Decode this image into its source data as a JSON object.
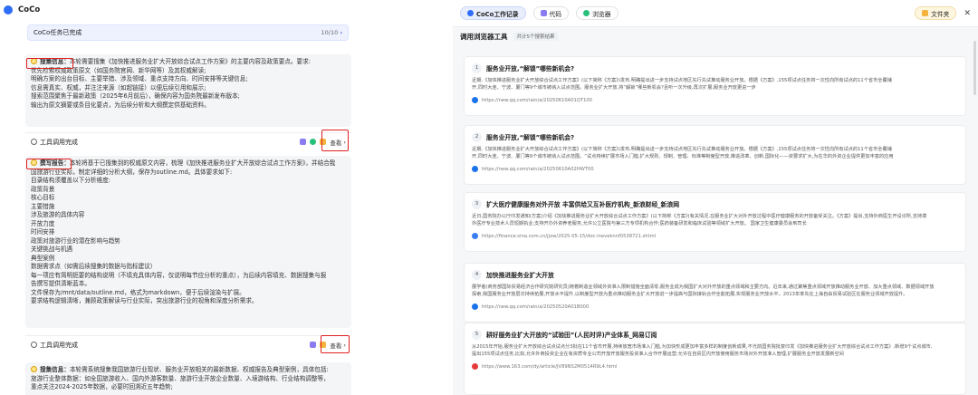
{
  "app": {
    "name": "CoCo"
  },
  "task_banner": {
    "text": "CoCo任务已完成",
    "count": "10/10"
  },
  "blocks": [
    {
      "title": "搜集信息：",
      "lines": [
        "本轮需要搜集《加快推进服务业扩大开放综合试点工作方案》的主要内容及政策要点。要求:",
        "优先检索权威政策原文（如国务院官网、新华网等）及其权威解读;",
        "明确方案的出台目标、主要举措、涉及领域、重点支持方向、时间安排等关键信息;",
        "信息需真实、权威，并注注来源（如超链接）以便后续引用和展示;",
        "搜索范围聚焦于最新政策（2025年6月前后），确保内容为国务院最新发布版本;",
        "输出为原文摘要或条目化要点，为后续分析和大纲撰定供基础资料。"
      ]
    },
    {
      "title": "撰写报告：",
      "lines": [
        "本轮将基于已搜集到的权威原文内容，梳理《加快推进服务业扩大开放综合试点工作方案》，并结合我",
        "国旅游行业实际，制定详细的分析大纲，保存为outline.md。具体要求如下:",
        "目录结构须覆盖以下分析维度:",
        "政策背景",
        "核心目标",
        "主要措施",
        "涉及旅游的具体内容",
        "开放力度",
        "时间安排",
        "政策对旅游行业的潜在影响与趋势",
        "关键挑战与机遇",
        "典型案例",
        "数据需求点（如需后续搜集的数据与指标建议）",
        "每一项应有简明扼要的结构说明（不填充具体内容，仅说明每节应分析的重点），为后续内容填充、数据搜集与报",
        "告撰写提供清晰蓝本。",
        "文件保存为/mnt/data/outline.md，格式为markdown，便于后续渲染与扩展。",
        "要求结构逻辑清晰，兼顾政策解读与行业实际，突出旅游行业的视角和深度分析需求。"
      ]
    },
    {
      "title": "搜集信息：",
      "lines": [
        "本轮需系统搜集我国旅游行业现状、服务业开放相关的最新数据、权威报告及典型案例，具体包括:",
        "旅游行业整体数据：如全国旅游收入、国内外游客数量、旅游行业开放企业数量、入境游结构、行业结构调整等，",
        "重点关注2024-2025年数据，必要时回溯近五年趋势;"
      ]
    }
  ],
  "tool_rows": [
    {
      "label": "工具调用完成",
      "view": "查看"
    },
    {
      "label": "工具调用完成",
      "view": "查看"
    }
  ],
  "right_header": {
    "record": "CoCo工作记录",
    "tab_code": "代码",
    "tab_browser": "浏览器",
    "files": "文件夹"
  },
  "section": {
    "title": "调用浏览器工具",
    "tag": "共计5个搜索结果"
  },
  "results": [
    {
      "num": "1",
      "title": "服务业开放,“解锁”哪些新机会?",
      "body": [
        "近期,《加快推进服务业扩大开放综合试点工作方案》(以下简称《方案》)发布,明确提出进一步支持试点地区先行先试推动服务业开放。根据《方案》,155项试点任务将一次性向所有试点的11个省市全覆铺",
        "开,同时大连、宁波、厦门等9个城市被纳入试点范围。服务业扩大开放,将“解锁”哪些新机会?且听一次升级,再次扩展,服务业开放更进一步"
      ],
      "url": "https://new.qq.com/rain/a/20250610A01QT100",
      "color": "#1a73e8"
    },
    {
      "num": "2",
      "title": "服务业开放,“解锁”哪些新机会?",
      "body": [
        "近期,《加快推进服务业扩大开放综合试点工作方案》(以下简称《方案》)发布,明确提出进一步支持试点地区先行先试推动服务业开放。根据《方案》,155项试点任务将一次性向所有试点的11个省市全覆铺",
        "开,同时大连、宁波、厦门等9个城市被纳入试点范围。“试点持续扩展市场入门槛,扩大规则、规制、管理、标准等制度型开放,推进改革、创新,国际化——资要求扩大,为在华的外资企业提供更加丰富的应用"
      ],
      "url": "https://new.qq.com/rain/a/20250610A02HWT00",
      "color": "#1a73e8"
    },
    {
      "num": "3",
      "title": "扩大医疗健康服务对外开放 丰富供给又互补医疗机构_新浪财经_新浪网",
      "body": [
        "近日,国务院办公厅印发通知(方案)介绍《加快推进服务业扩大开放综合试点工作方案》(以下简称《方案》)有关情况,在服务业扩大对外开放过程中医疗健康服务的开放备受关注。《方案》提出,支持外商医生开设诊所,支持境",
        "外医疗专业技术人员短期执业;支持开办外资养老服务,允许公立医院与第三方专项机构合作;医药装备研发和临床试验等领域扩大开放。 国家卫生健康委员会到司长"
      ],
      "url": "https://finance.sina.com.cn/jjxw/2025-05-15/doc-ineveknnf0538721.shtml",
      "color": "#3b7cf0"
    },
    {
      "num": "4",
      "title": "加快推进服务业扩大开放",
      "body": [
        "展学者(商务部国际贸易经济合作研究院研究员)随着制造业领域外资准入限制措施全面清零,服务业成为我国扩大对外开放的重点领域和主要方向。近年来,通过聚焦重点领域开放推动服务业开放、加大重点领域、数据领域开放",
        "探索,我国服务业开放层次持续拓展,开放水平提升,以制度型开放为重点推动服务业扩大开放进一步提高与国际接轨合作全能拓展,实现服务业开放水平。2013年率先在上海自由贸易试验区在服务业领域开放提升。"
      ],
      "url": "https://new.qq.com/rain/a/20250520A01B000",
      "color": "#1a73e8"
    },
    {
      "num": "5",
      "title": "耕好服务业扩大开放的“试验田”(人民时评)产业体系_网易订阅",
      "body": [
        "从2015年开始,服务业扩大开放综合试点试点分3批在11个省市开展,持续放宽市场准入门槛,为加快形成更加丰富多样的制度创新成果,不光前国务院批复印发《加快推进服务业扩大开放综合试点工作方案》,新增9个试点城市,",
        "提出155项试点任务,比如,允许外商投资企业在有资质专业公司开放开放服务投资准入合作开展运营;允许在自贸区内开放使用服务市场对外开放准入管理,扩展服务业开放发展新空间"
      ],
      "url": "https://www.163.com/dy/article/JV89NS2M0514R9L4.html",
      "color": "#e43a3a"
    }
  ]
}
